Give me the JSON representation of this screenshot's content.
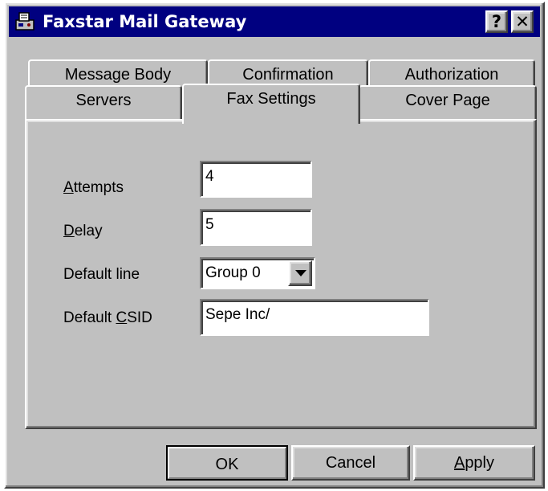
{
  "window": {
    "title": "Faxstar Mail Gateway",
    "app_icon": "fax-machine-icon",
    "help_glyph": "?",
    "close_glyph": "✕"
  },
  "tabs": {
    "row_back": [
      {
        "label": "Message Body"
      },
      {
        "label": "Confirmation"
      },
      {
        "label": "Authorization"
      }
    ],
    "row_front": [
      {
        "label": "Servers"
      },
      {
        "label": "Fax Settings",
        "selected": true
      },
      {
        "label": "Cover Page"
      }
    ]
  },
  "fields": {
    "attempts": {
      "label_accel": "A",
      "label_rest": "ttempts",
      "value": "4"
    },
    "delay": {
      "label_accel": "D",
      "label_rest": "elay",
      "value": "5"
    },
    "default_line": {
      "label": "Default line",
      "value": "Group 0"
    },
    "csid": {
      "label_pre": "Default ",
      "label_accel": "C",
      "label_rest": "SID",
      "value": "Sepe Inc/"
    }
  },
  "buttons": {
    "ok": "OK",
    "cancel": "Cancel",
    "apply_accel": "A",
    "apply_rest": "pply"
  }
}
